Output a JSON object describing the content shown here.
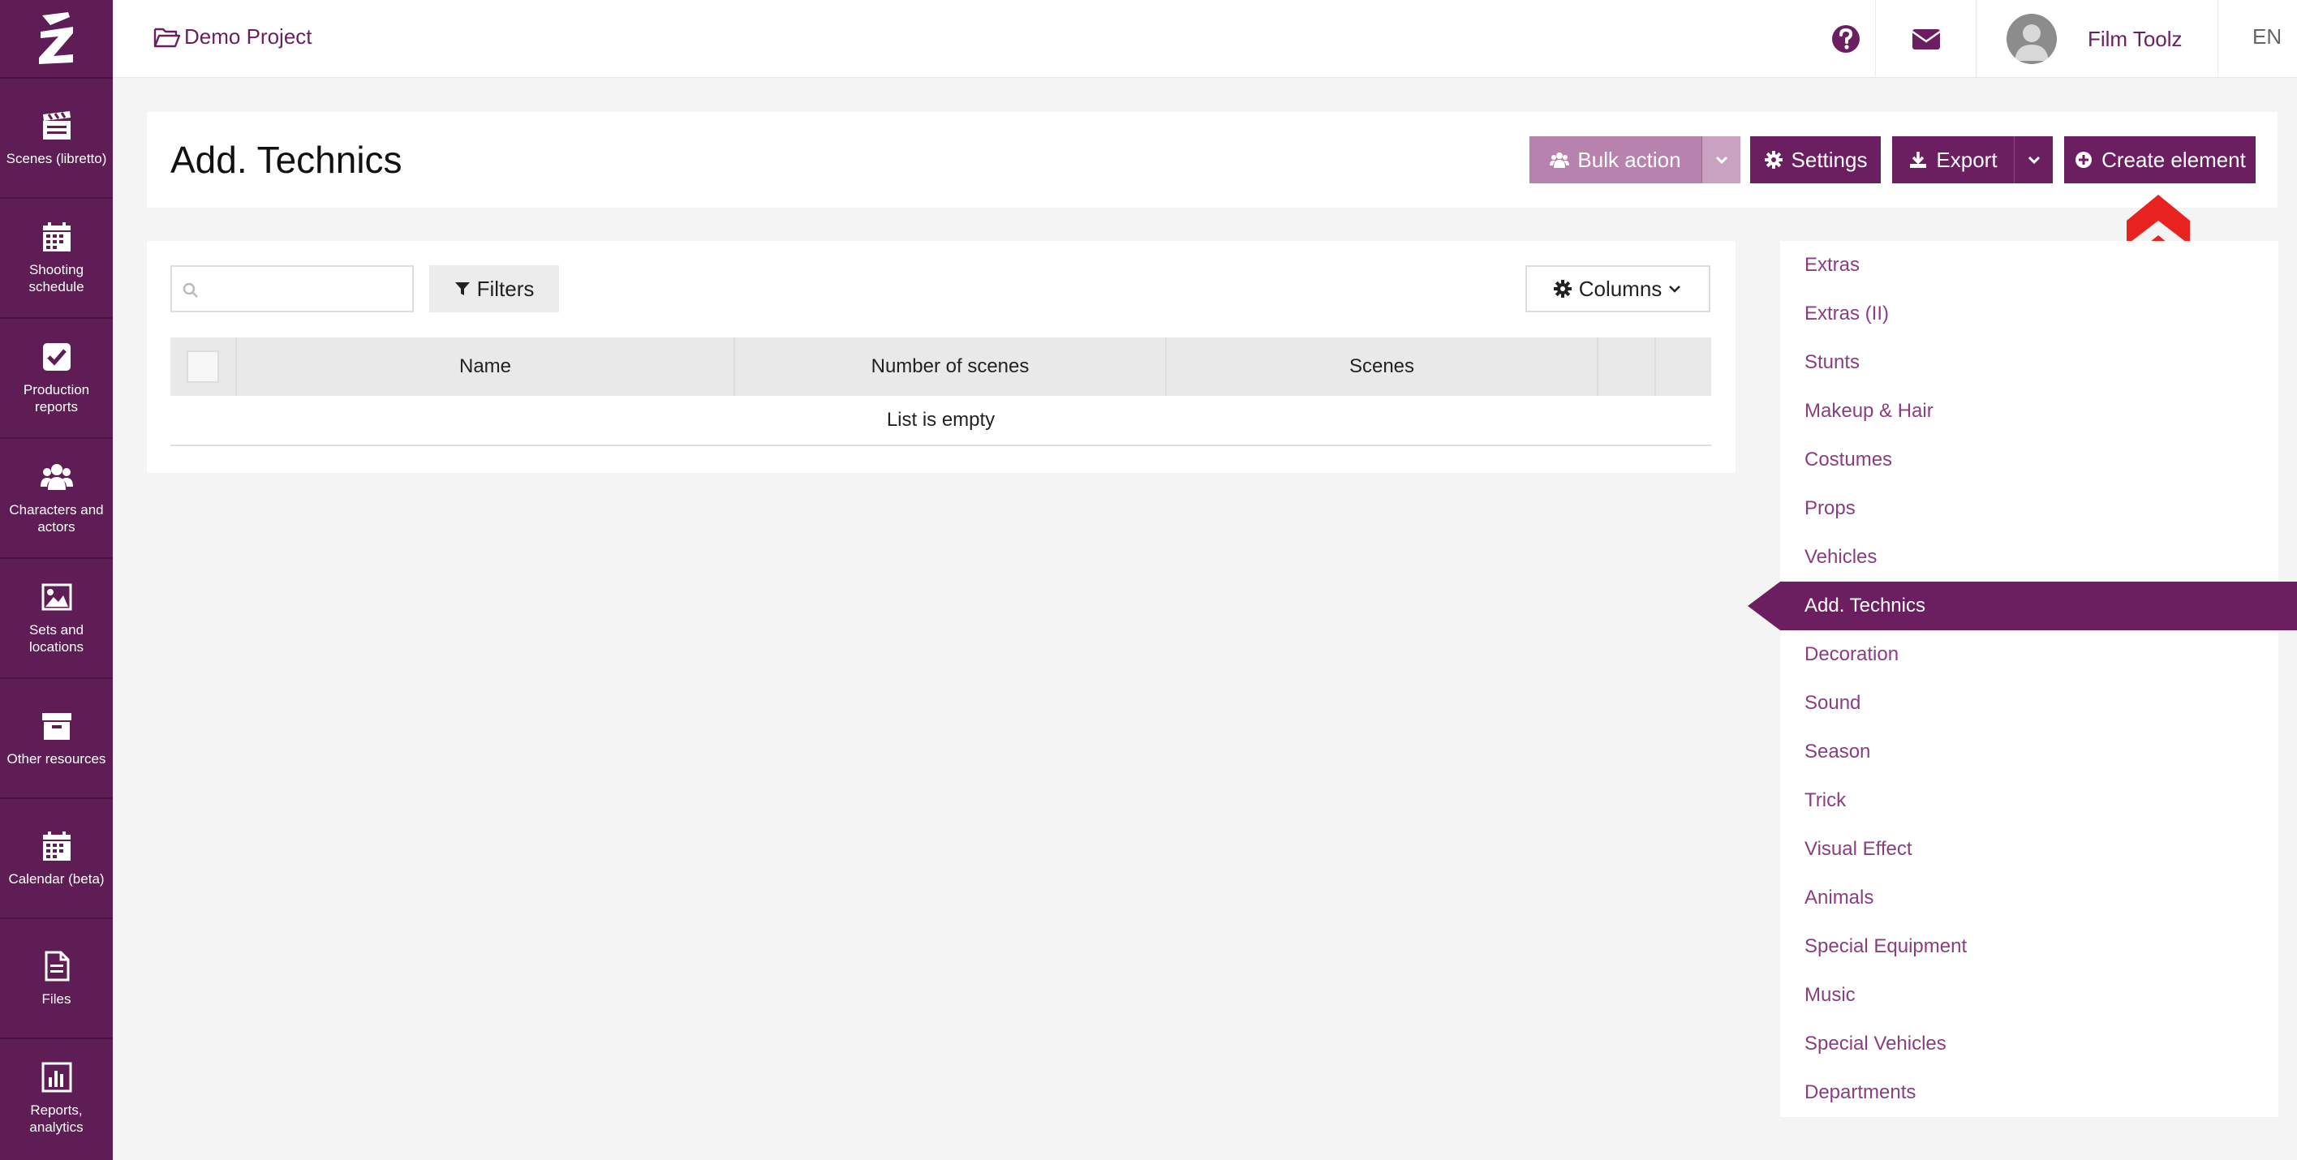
{
  "sidebar": {
    "logo": "Z",
    "items": [
      {
        "label": "Scenes (libretto)",
        "icon": "clapperboard-icon"
      },
      {
        "label": "Shooting schedule",
        "icon": "calendar-icon"
      },
      {
        "label": "Production reports",
        "icon": "checkbox-icon"
      },
      {
        "label": "Characters and actors",
        "icon": "users-icon"
      },
      {
        "label": "Sets and locations",
        "icon": "image-icon"
      },
      {
        "label": "Other resources",
        "icon": "archive-box-icon"
      },
      {
        "label": "Calendar (beta)",
        "icon": "calendar-grid-icon"
      },
      {
        "label": "Files",
        "icon": "file-icon"
      },
      {
        "label": "Reports, analytics",
        "icon": "bar-chart-icon"
      }
    ]
  },
  "topbar": {
    "project_name": "Demo Project",
    "help_icon": "question-circle-icon",
    "mail_icon": "envelope-icon",
    "user_name": "Film Toolz",
    "language": "EN"
  },
  "header": {
    "title": "Add. Technics",
    "bulk_action_label": "Bulk action",
    "settings_label": "Settings",
    "export_label": "Export",
    "create_label": "Create element"
  },
  "table": {
    "search_placeholder": "",
    "filters_label": "Filters",
    "columns_label": "Columns",
    "headers": [
      "Name",
      "Number of scenes",
      "Scenes"
    ],
    "empty_text": "List is empty"
  },
  "categories": {
    "items": [
      "Extras",
      "Extras (II)",
      "Stunts",
      "Makeup & Hair",
      "Costumes",
      "Props",
      "Vehicles",
      "Add. Technics",
      "Decoration",
      "Sound",
      "Season",
      "Trick",
      "Visual Effect",
      "Animals",
      "Special Equipment",
      "Music",
      "Special Vehicles",
      "Departments"
    ],
    "active": "Add. Technics"
  },
  "colors": {
    "brand": "#6b1f60",
    "sidebar": "#5e1d55",
    "link": "#8a3d80",
    "arrow": "#e8231f"
  }
}
